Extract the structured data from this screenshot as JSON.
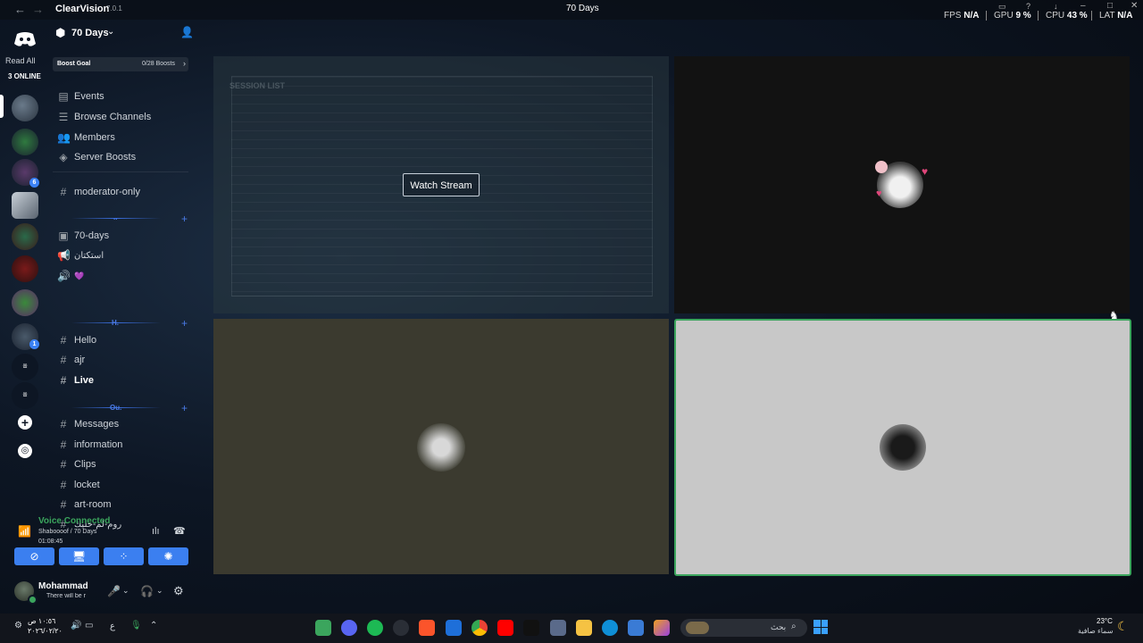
{
  "titlebar": {
    "app_name": "ClearVision",
    "app_version": "7.0.1",
    "window_title": "70 Days",
    "fps_label": "FPS",
    "fps_value": "N/A",
    "gpu_label": "GPU",
    "gpu_value": "9 %",
    "cpu_label": "CPU",
    "cpu_value": "43 %",
    "lat_label": "LAT",
    "lat_value": "N/A"
  },
  "rail": {
    "read_all": "Read All",
    "online": "3 ONLINE",
    "badges": [
      "6",
      "1"
    ]
  },
  "server": {
    "name": "70 Days",
    "boost_goal_label": "Boost Goal",
    "boost_count": "0/28 Boosts"
  },
  "channels": {
    "nav": [
      "Events",
      "Browse Channels",
      "Members",
      "Server Boosts"
    ],
    "moderator": "moderator-only",
    "cat1": "..",
    "voice1": [
      "70-days",
      "استكتان",
      "💜"
    ],
    "cat2": "H.",
    "text2": [
      "Hello",
      "ajr",
      "Live"
    ],
    "cat3": "Ou.",
    "text3": [
      "Messages",
      "information",
      "Clips",
      "locket",
      "art-room",
      "روم-لم-حليك"
    ]
  },
  "voice": {
    "status": "Voice Connected",
    "channel": "Shaboooof / 70 Days",
    "timer": "01:08:45"
  },
  "user": {
    "name": "Mohammad",
    "status": "There will be r"
  },
  "stage": {
    "watch_stream": "Watch Stream"
  },
  "taskbar": {
    "time": "١٠:٥٦ ص",
    "date": "٢٠٢٦/٠٢/٢٠",
    "lang": "ع",
    "search_placeholder": "بحث",
    "weather_temp": "23°C",
    "weather_desc": "سماء صافية"
  },
  "colors": {
    "accent": "#3b7ff0",
    "voice_green": "#3ba55d",
    "speaking_border": "#3ba55d",
    "tile_olive": "#3b3a2f",
    "tile_light": "#c8c8c8"
  }
}
